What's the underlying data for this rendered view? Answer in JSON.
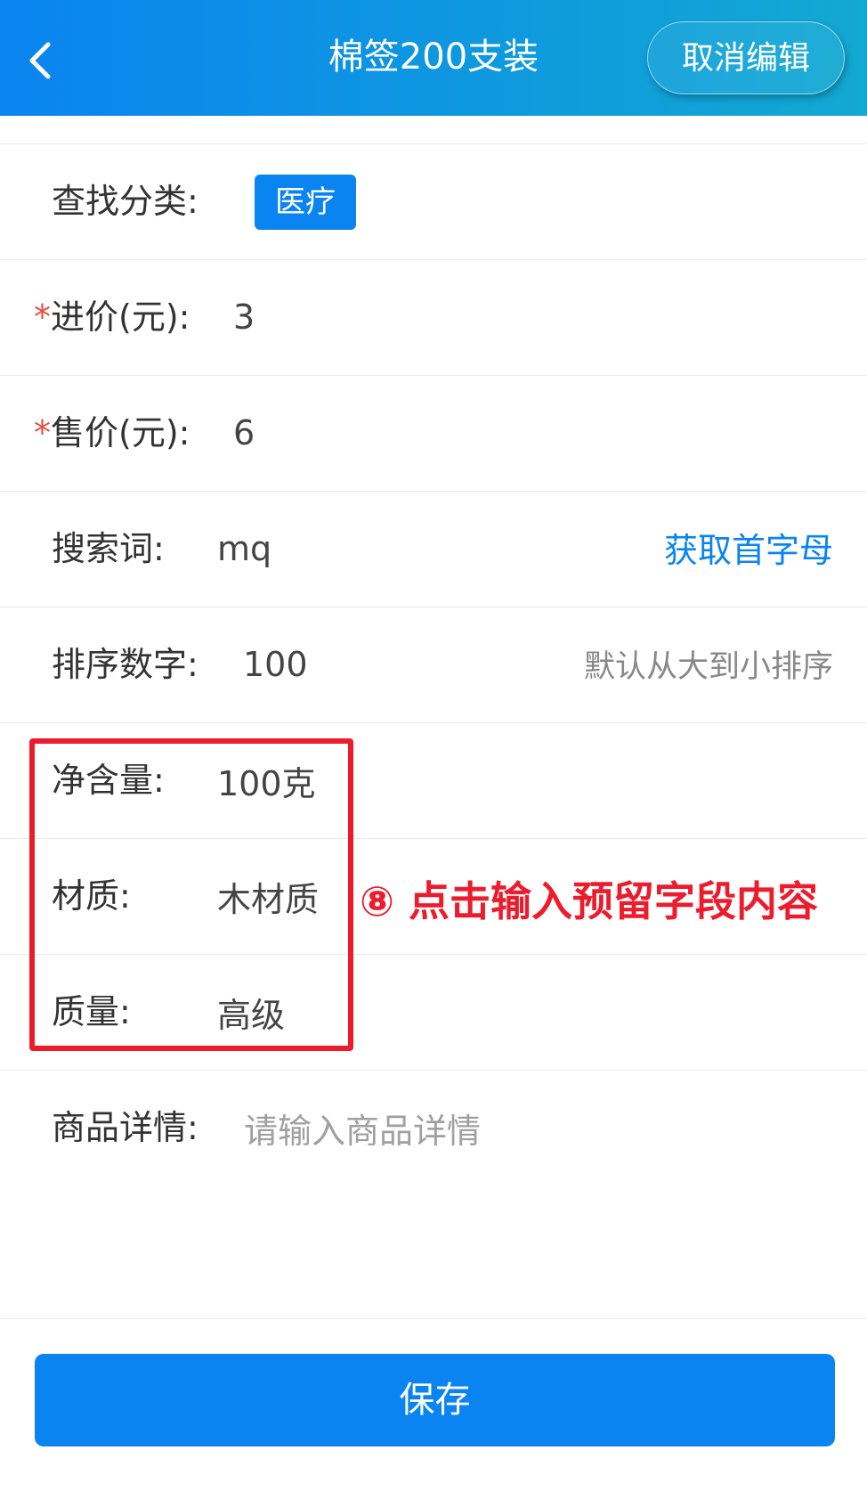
{
  "header": {
    "title": "棉签200支装",
    "cancel_label": "取消编辑",
    "back_icon": "chevron-left-icon"
  },
  "form": {
    "category": {
      "label": "查找分类:",
      "tag": "医疗"
    },
    "purchase_price": {
      "required_mark": "*",
      "label": "进价(元):",
      "value": "3"
    },
    "sale_price": {
      "required_mark": "*",
      "label": "售价(元):",
      "value": "6"
    },
    "search_term": {
      "label": "搜索词:",
      "value": "mq",
      "action": "获取首字母"
    },
    "sort_number": {
      "label": "排序数字:",
      "value": "100",
      "hint": "默认从大到小排序"
    },
    "net_content": {
      "label": "净含量:",
      "value": "100克"
    },
    "material": {
      "label": "材质:",
      "value": "木材质"
    },
    "quality": {
      "label": "质量:",
      "value": "高级"
    },
    "details": {
      "label": "商品详情:",
      "placeholder": "请输入商品详情"
    }
  },
  "annotation": {
    "text": "⑧ 点击输入预留字段内容",
    "color": "#ec1c2d"
  },
  "footer": {
    "save_label": "保存"
  },
  "colors": {
    "primary": "#0a84f0",
    "header_gradient_end": "#12a9d2",
    "required": "#e54d42"
  }
}
